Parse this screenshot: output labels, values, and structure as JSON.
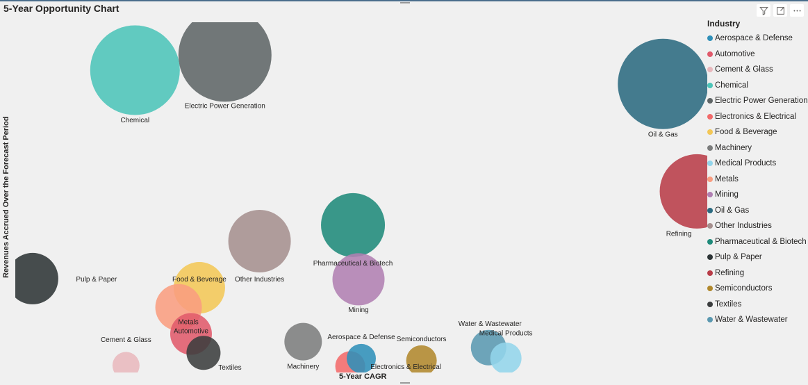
{
  "visual": {
    "title": "5-Year Opportunity Chart",
    "header_icons": [
      {
        "name": "filter-icon"
      },
      {
        "name": "focus-mode-icon"
      },
      {
        "name": "more-options-icon"
      }
    ]
  },
  "legend": {
    "title": "Industry",
    "placement": "right"
  },
  "chart_data": {
    "type": "scatter",
    "title": "5-Year Opportunity Chart",
    "xlabel": "5-Year CAGR",
    "ylabel": "Revenues Accrued Over the Forecast Period",
    "xlim": [
      0,
      100
    ],
    "ylim": [
      0,
      100
    ],
    "grid": false,
    "legend_title": "Industry",
    "note": "Axis tick labels are not shown; x/y are relative positions (0-100) and size is relative bubble size.",
    "series": [
      {
        "name": "Aerospace & Defense",
        "color": "#2f8fb8",
        "x": 50.0,
        "y": 4.0,
        "size": 4.2,
        "label": "Aerospace & Defense"
      },
      {
        "name": "Automotive",
        "color": "#e05a6b",
        "x": 25.4,
        "y": 11.0,
        "size": 6.0,
        "label": "Automotive"
      },
      {
        "name": "Cement & Glass",
        "color": "#e8b8bd",
        "x": 16.0,
        "y": 2.0,
        "size": 3.9,
        "label": "Cement & Glass"
      },
      {
        "name": "Chemical",
        "color": "#4cc4b8",
        "x": 17.3,
        "y": 86.3,
        "size": 12.9,
        "label": "Chemical"
      },
      {
        "name": "Electric Power Generation",
        "color": "#5f6566",
        "x": 30.3,
        "y": 90.6,
        "size": 13.4,
        "label": "Electric Power Generation"
      },
      {
        "name": "Electronics & Electrical",
        "color": "#f26a6a",
        "x": 48.4,
        "y": 1.8,
        "size": 4.3,
        "label": "Electronics & Electrical"
      },
      {
        "name": "Food & Beverage",
        "color": "#f3c757",
        "x": 26.6,
        "y": 24.2,
        "size": 7.4,
        "label": "Food & Beverage"
      },
      {
        "name": "Machinery",
        "color": "#7c7d7d",
        "x": 41.6,
        "y": 8.8,
        "size": 5.4,
        "label": "Machinery"
      },
      {
        "name": "Medical Products",
        "color": "#93d5eb",
        "x": 70.9,
        "y": 4.1,
        "size": 4.5,
        "label": "Medical Products"
      },
      {
        "name": "Metals",
        "color": "#f99d80",
        "x": 23.6,
        "y": 18.6,
        "size": 6.7,
        "label": "Metals"
      },
      {
        "name": "Mining",
        "color": "#b07fb2",
        "x": 49.6,
        "y": 26.6,
        "size": 7.5,
        "label": "Mining"
      },
      {
        "name": "Oil & Gas",
        "color": "#2b6a80",
        "x": 93.6,
        "y": 82.4,
        "size": 13.0,
        "label": "Oil & Gas"
      },
      {
        "name": "Other Industries",
        "color": "#a58f8e",
        "x": 35.3,
        "y": 37.5,
        "size": 9.0,
        "label": "Other Industries"
      },
      {
        "name": "Pharmaceutical & Biotech",
        "color": "#1f8a7a",
        "x": 48.8,
        "y": 42.1,
        "size": 9.2,
        "label": "Pharmaceutical & Biotech"
      },
      {
        "name": "Pulp & Paper",
        "color": "#2d3436",
        "x": 2.5,
        "y": 26.8,
        "size": 7.4,
        "label": "Pulp & Paper"
      },
      {
        "name": "Refining",
        "color": "#b83c48",
        "x": 98.5,
        "y": 51.7,
        "size": 10.7,
        "label": "Refining"
      },
      {
        "name": "Semiconductors",
        "color": "#b0882c",
        "x": 58.7,
        "y": 3.4,
        "size": 4.4,
        "label": "Semiconductors"
      },
      {
        "name": "Textiles",
        "color": "#3b3d3e",
        "x": 27.2,
        "y": 5.6,
        "size": 4.9,
        "label": "Textiles"
      },
      {
        "name": "Water & Wastewater",
        "color": "#5a98b0",
        "x": 68.4,
        "y": 7.1,
        "size": 5.1,
        "label": "Water & Wastewater"
      }
    ]
  }
}
